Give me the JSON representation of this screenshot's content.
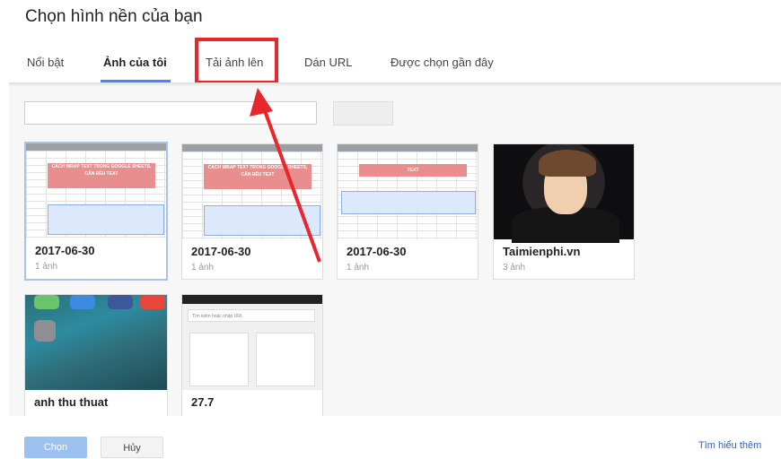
{
  "dialog": {
    "title": "Chọn hình nền của bạn"
  },
  "tabs": [
    {
      "label": "Nổi bật",
      "active": false
    },
    {
      "label": "Ảnh của tôi",
      "active": true
    },
    {
      "label": "Tải ảnh lên",
      "active": false,
      "highlighted": true
    },
    {
      "label": "Dán URL",
      "active": false
    },
    {
      "label": "Được chọn gần đây",
      "active": false
    }
  ],
  "search": {
    "value": "",
    "placeholder": ""
  },
  "albums": [
    {
      "title": "2017-06-30",
      "count": "1 ảnh",
      "selected": true,
      "thumb": "spreadsheet",
      "thumb_text": "CÁCH WRAP TEXT TRONG GOOGLE SHEETS, CĂN ĐỀU TEXT"
    },
    {
      "title": "2017-06-30",
      "count": "1 ảnh",
      "selected": false,
      "thumb": "spreadsheet",
      "thumb_text": "CÁCH WRAP TEXT TRONG GOOGLE SHEETS, CĂN ĐỀU TEXT"
    },
    {
      "title": "2017-06-30",
      "count": "1 ảnh",
      "selected": false,
      "thumb": "spreadsheet",
      "thumb_text": "TEXT"
    },
    {
      "title": "Taimienphi.vn",
      "count": "3 ảnh",
      "selected": false,
      "thumb": "photo"
    },
    {
      "title": "anh thu thuat",
      "count": "",
      "selected": false,
      "thumb": "ios-homescreen"
    },
    {
      "title": "27.7",
      "count": "",
      "selected": false,
      "thumb": "android-browser",
      "thumb_text": "Tìm kiếm hoặc nhập URL"
    }
  ],
  "footer": {
    "choose_label": "Chọn",
    "cancel_label": "Hủy",
    "learn_more_label": "Tìm hiểu thêm"
  },
  "colors": {
    "accent": "#4285f4",
    "highlight": "#e8262b",
    "link": "#2a62c9"
  }
}
